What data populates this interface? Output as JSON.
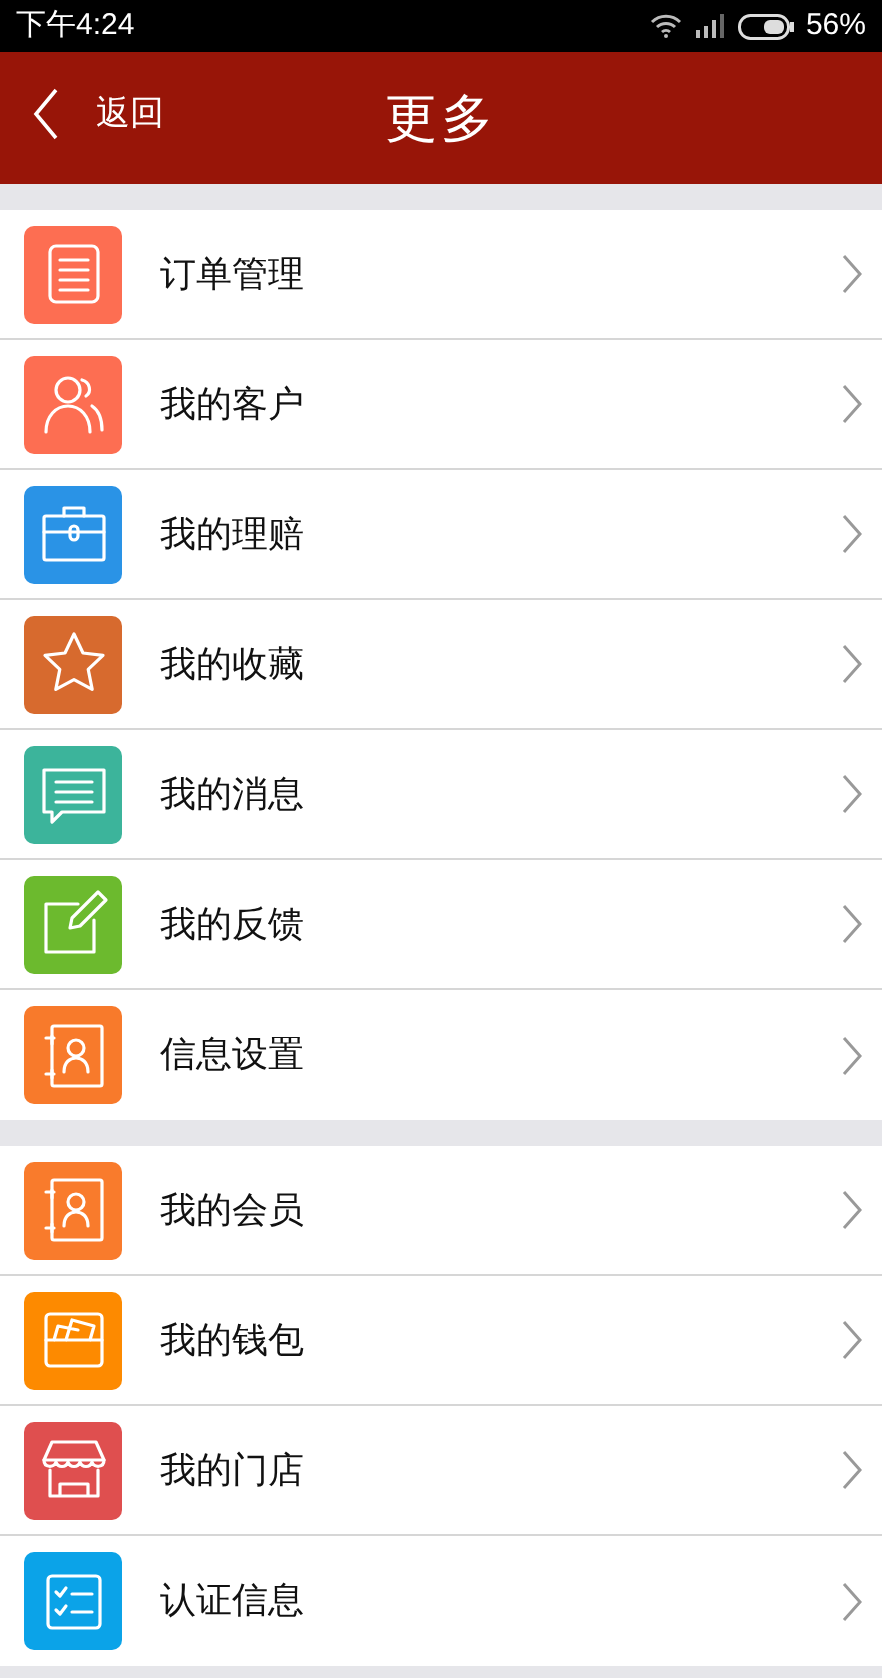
{
  "status_bar": {
    "time": "下午4:24",
    "battery": "56%"
  },
  "header": {
    "back": "返回",
    "title": "更多"
  },
  "groups": [
    {
      "items": [
        {
          "label": "订单管理",
          "kind": "list",
          "color": "#fd6e52"
        },
        {
          "label": "我的客户",
          "kind": "people",
          "color": "#fd6e52"
        },
        {
          "label": "我的理赔",
          "kind": "case",
          "color": "#2a93e6"
        },
        {
          "label": "我的收藏",
          "kind": "star",
          "color": "#d76a2e"
        },
        {
          "label": "我的消息",
          "kind": "chat",
          "color": "#3cb49b"
        },
        {
          "label": "我的反馈",
          "kind": "edit",
          "color": "#6cba2e"
        },
        {
          "label": "信息设置",
          "kind": "contact",
          "color": "#f87a2b"
        }
      ]
    },
    {
      "items": [
        {
          "label": "我的会员",
          "kind": "contact",
          "color": "#f97b2c"
        },
        {
          "label": "我的钱包",
          "kind": "wallet",
          "color": "#fd8a00"
        },
        {
          "label": "我的门店",
          "kind": "store",
          "color": "#df4f4f"
        },
        {
          "label": "认证信息",
          "kind": "checklist",
          "color": "#0ba3e8"
        }
      ]
    }
  ]
}
